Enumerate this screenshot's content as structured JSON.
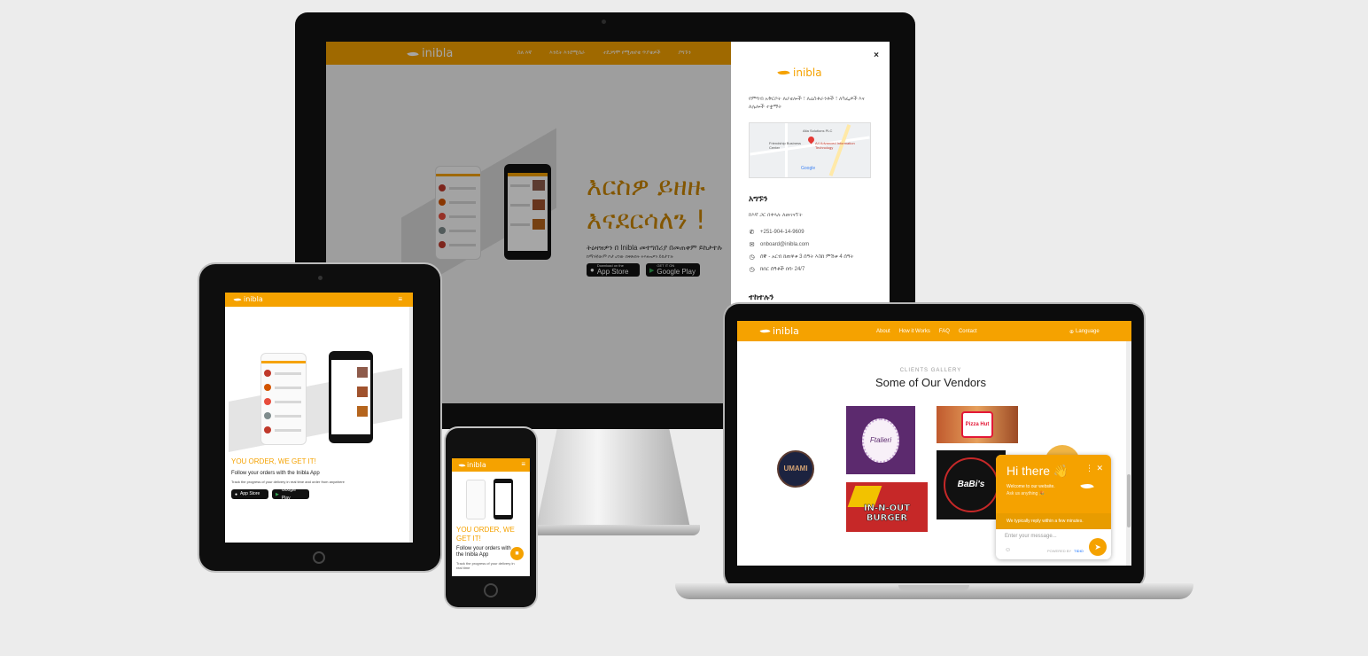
{
  "brand": {
    "name": "inibla",
    "color": "#f5a200"
  },
  "imac": {
    "nav": [
      "ስለ እኛ",
      "እንዴት እንደሚሰራ",
      "ተደጋግሞ የሚጠየቁ ጥያቄዎች",
      "ያግኙን"
    ],
    "hero_line1": "እርስዎ ይዘዙ",
    "hero_line2": "እናደርሳለን !",
    "hero_sub1": "ትዕዛዝዎን በ Inibla መተግበሪያ በመጠቀም ይከታተሉ",
    "hero_sub2": "ከማንኛውም ቦታ ሆነው በቅጽበት ትእዛዝዎን ይከታተሉ",
    "app_store_small": "Download on the",
    "app_store": "App Store",
    "google_play_small": "GET IT ON",
    "google_play": "Google Play",
    "panel": {
      "close": "×",
      "intro": "የምግብ አቅርቦት ለሆቴሎች ፣ ለሬስቶራንቶች ፣ ለካፌዎች እና ለሌሎች ተቋማት",
      "map_labels": [
        "Alta Solutions PLC",
        "Friendship Business Center",
        "A4 Advanced Information Technology",
        "Google"
      ],
      "contact_title": "አግኙን",
      "contact_sub": "ከእኛ ጋር በቀላሉ ለመገናኘት",
      "phone": "+251-904-14-9609",
      "email": "onboard@inibla.com",
      "hours": "ሰኞ - አርብ ከጠዋቱ 3 ሰዓት እስከ ምሽቱ 4 ሰዓት",
      "support": "ክበር ሰዓቶች በሳ፡ 24/7",
      "follow_title": "ተከተሉን"
    }
  },
  "tablet": {
    "headline": "YOU ORDER, WE GET IT!",
    "sub": "Follow your orders with the Inibla App",
    "sub2": "Track the progress of your delivery in real time and order from anywhere",
    "app_store": "App Store",
    "google_play": "Google Play"
  },
  "phone": {
    "headline_line1": "YOU ORDER, WE",
    "headline_line2": "GET IT!",
    "sub": "Follow your orders with the Inibla App",
    "sub2": "Track the progress of your delivery in real time"
  },
  "laptop": {
    "nav": [
      "About",
      "How it Works",
      "FAQ",
      "Contact"
    ],
    "language": "Language",
    "gallery_label": "CLIENTS GALLERY",
    "gallery_title": "Some of Our Vendors",
    "vendors": [
      "UMAMI",
      "Ftalieri",
      "Pizza Hut",
      "BaBi's BISTRO",
      "IN-N-OUT BURGER"
    ],
    "chat": {
      "title": "Hi there 👋",
      "line1": "Welcome to our website.",
      "line2": "Ask us anything 🎉",
      "reply_time": "We typically reply within a few minutes.",
      "placeholder": "Enter your message...",
      "powered": "POWERED BY",
      "powered_brand": "TIDIO"
    }
  }
}
